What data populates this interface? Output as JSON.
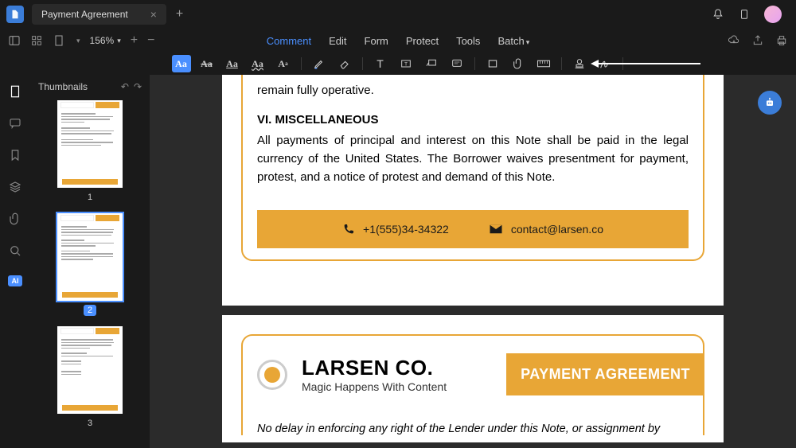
{
  "titlebar": {
    "tab_title": "Payment Agreement"
  },
  "toolbar": {
    "zoom": "156%"
  },
  "menu": {
    "comment": "Comment",
    "edit": "Edit",
    "form": "Form",
    "protect": "Protect",
    "tools": "Tools",
    "batch": "Batch"
  },
  "tool_labels": {
    "aa": "Aa",
    "text": "T"
  },
  "rail": {
    "ai": "AI"
  },
  "thumbs": {
    "header": "Thumbnails",
    "items": [
      {
        "num": "1"
      },
      {
        "num": "2"
      },
      {
        "num": "3"
      }
    ]
  },
  "doc": {
    "page1": {
      "line1": "remain fully operative.",
      "h_misc": "VI. MISCELLANEOUS",
      "misc_body": "All payments of principal and interest on this Note shall be paid in the legal currency of the United States. The Borrower waives presentment for payment, protest, and a notice of protest and demand of this Note.",
      "phone": "+1(555)34-34322",
      "email": "contact@larsen.co"
    },
    "page2": {
      "brand": "LARSEN CO.",
      "tagline": "Magic Happens With Content",
      "title": "PAYMENT AGREEMENT",
      "intro": "No delay in enforcing any right of the Lender under this Note, or assignment by"
    }
  }
}
